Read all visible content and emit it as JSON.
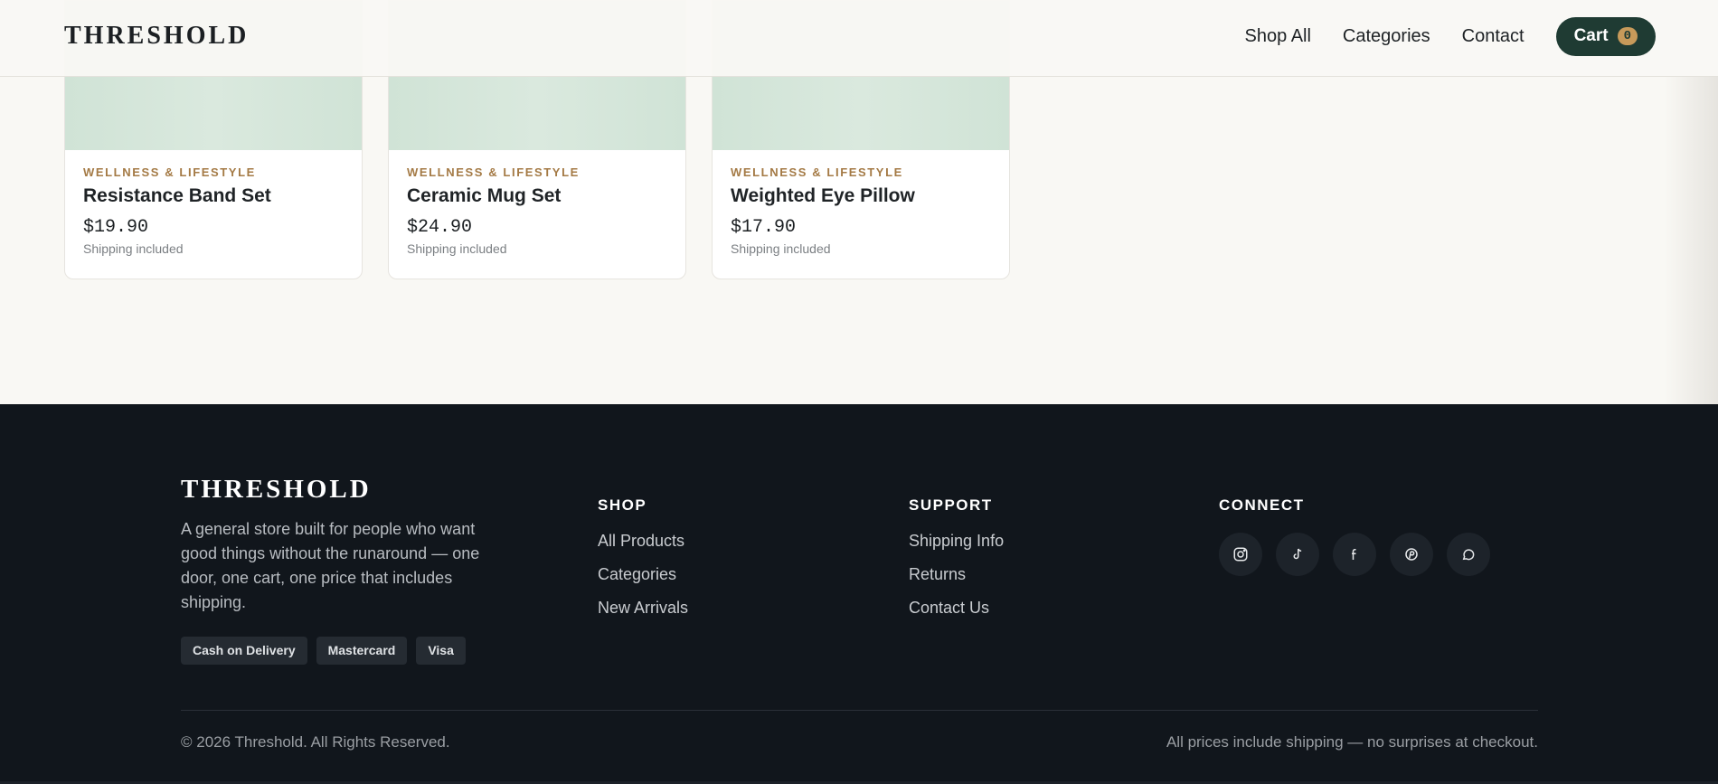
{
  "header": {
    "logo": "THRESHOLD",
    "nav": [
      "Shop All",
      "Categories",
      "Contact"
    ],
    "cart_label": "Cart",
    "cart_count": "0"
  },
  "products": [
    {
      "category": "WELLNESS & LIFESTYLE",
      "name": "Resistance Band Set",
      "price": "$19.90",
      "shipping": "Shipping included"
    },
    {
      "category": "WELLNESS & LIFESTYLE",
      "name": "Ceramic Mug Set",
      "price": "$24.90",
      "shipping": "Shipping included"
    },
    {
      "category": "WELLNESS & LIFESTYLE",
      "name": "Weighted Eye Pillow",
      "price": "$17.90",
      "shipping": "Shipping included"
    }
  ],
  "footer": {
    "logo": "THRESHOLD",
    "description": "A general store built for people who want good things without the runaround — one door, one cart, one price that includes shipping.",
    "payments": [
      "Cash on Delivery",
      "Mastercard",
      "Visa"
    ],
    "shop": {
      "heading": "SHOP",
      "links": [
        "All Products",
        "Categories",
        "New Arrivals"
      ]
    },
    "support": {
      "heading": "SUPPORT",
      "links": [
        "Shipping Info",
        "Returns",
        "Contact Us"
      ]
    },
    "connect": {
      "heading": "CONNECT",
      "icons": [
        "instagram-icon",
        "tiktok-icon",
        "facebook-icon",
        "pinterest-icon",
        "whatsapp-icon"
      ]
    },
    "copyright": "© 2026 Threshold. All Rights Reserved.",
    "note": "All prices include shipping — no surprises at checkout."
  },
  "colors": {
    "accent": "#1f3b33",
    "gold": "#c79a5a",
    "footer_bg": "#11161c"
  }
}
